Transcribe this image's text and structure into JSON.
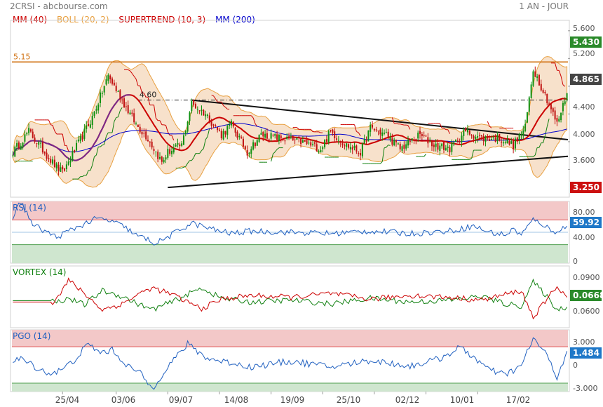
{
  "header": {
    "symbol": "2CRSI - abcbourse.com",
    "period": "1 AN - JOUR"
  },
  "chart_data": [
    {
      "type": "candlestick",
      "legend": [
        {
          "name": "MM (40)",
          "color": "#cc0000"
        },
        {
          "name": "BOLL (20, 2)",
          "color": "#e8a040"
        },
        {
          "name": "SUPERTREND (10, 3)",
          "color": "#cc0000"
        },
        {
          "name": "MM (200)",
          "color": "#0000cc"
        }
      ],
      "yticks": [
        "5.600",
        "5.200",
        "4.800",
        "4.400",
        "4.000",
        "3.600"
      ],
      "ylim": [
        3.2,
        5.75
      ],
      "last_price": "4.865",
      "last_high": "5.430",
      "last_low": "3.250",
      "level_label": "5.15",
      "level_value": 5.15,
      "neckline_label": "4.60",
      "neckline_value": 4.6,
      "price_anchors": [
        [
          0,
          3.85
        ],
        [
          8,
          4.15
        ],
        [
          20,
          3.7
        ],
        [
          25,
          3.55
        ],
        [
          40,
          4.35
        ],
        [
          48,
          4.95
        ],
        [
          55,
          4.6
        ],
        [
          62,
          4.25
        ],
        [
          68,
          4.05
        ],
        [
          75,
          3.7
        ],
        [
          78,
          3.85
        ],
        [
          85,
          3.95
        ],
        [
          90,
          4.55
        ],
        [
          97,
          4.4
        ],
        [
          105,
          4.1
        ],
        [
          110,
          4.25
        ],
        [
          118,
          3.85
        ],
        [
          125,
          4.1
        ],
        [
          135,
          4.05
        ],
        [
          145,
          4.0
        ],
        [
          155,
          3.9
        ],
        [
          160,
          4.15
        ],
        [
          168,
          3.95
        ],
        [
          175,
          3.85
        ],
        [
          180,
          4.2
        ],
        [
          188,
          4.1
        ],
        [
          195,
          3.9
        ],
        [
          205,
          4.1
        ],
        [
          212,
          3.95
        ],
        [
          220,
          3.9
        ],
        [
          228,
          4.15
        ],
        [
          236,
          4.05
        ],
        [
          245,
          4.05
        ],
        [
          252,
          3.95
        ],
        [
          258,
          4.2
        ],
        [
          262,
          5.05
        ],
        [
          266,
          4.8
        ],
        [
          270,
          4.55
        ],
        [
          274,
          4.25
        ],
        [
          279,
          4.7
        ]
      ]
    },
    {
      "type": "line",
      "title": "RSI (14)",
      "yticks": [
        "80.00",
        "40.00",
        "0"
      ],
      "ylim": [
        0,
        100
      ],
      "zones": [
        70,
        30
      ],
      "last_value": "59.92",
      "anchors": [
        [
          0,
          75
        ],
        [
          4,
          100
        ],
        [
          10,
          62
        ],
        [
          22,
          42
        ],
        [
          32,
          58
        ],
        [
          42,
          72
        ],
        [
          50,
          68
        ],
        [
          58,
          55
        ],
        [
          62,
          45
        ],
        [
          68,
          38
        ],
        [
          72,
          32
        ],
        [
          78,
          42
        ],
        [
          90,
          65
        ],
        [
          100,
          55
        ],
        [
          110,
          48
        ],
        [
          120,
          52
        ],
        [
          140,
          50
        ],
        [
          160,
          48
        ],
        [
          180,
          52
        ],
        [
          200,
          48
        ],
        [
          220,
          52
        ],
        [
          232,
          60
        ],
        [
          240,
          50
        ],
        [
          248,
          46
        ],
        [
          252,
          55
        ],
        [
          256,
          46
        ],
        [
          262,
          70
        ],
        [
          266,
          65
        ],
        [
          272,
          50
        ],
        [
          279,
          60
        ]
      ]
    },
    {
      "type": "line",
      "title": "VORTEX (14)",
      "yticks": [
        "0.0900",
        "0.0600"
      ],
      "ylim": [
        0.045,
        0.11
      ],
      "last_value": "0.0668",
      "series": [
        {
          "name": "VI+",
          "color": "#108010",
          "anchors": [
            [
              0,
              0.0735
            ],
            [
              20,
              0.0735
            ],
            [
              22,
              0.072
            ],
            [
              28,
              0.076
            ],
            [
              36,
              0.069
            ],
            [
              45,
              0.084
            ],
            [
              55,
              0.078
            ],
            [
              62,
              0.071
            ],
            [
              70,
              0.064
            ],
            [
              80,
              0.072
            ],
            [
              95,
              0.087
            ],
            [
              105,
              0.076
            ],
            [
              120,
              0.072
            ],
            [
              140,
              0.074
            ],
            [
              160,
              0.07
            ],
            [
              180,
              0.076
            ],
            [
              200,
              0.072
            ],
            [
              220,
              0.074
            ],
            [
              236,
              0.078
            ],
            [
              248,
              0.07
            ],
            [
              256,
              0.068
            ],
            [
              262,
              0.093
            ],
            [
              268,
              0.08
            ],
            [
              274,
              0.064
            ],
            [
              279,
              0.0668
            ]
          ]
        },
        {
          "name": "VI-",
          "color": "#cc0000",
          "anchors": [
            [
              0,
              0.072
            ],
            [
              20,
              0.072
            ],
            [
              22,
              0.076
            ],
            [
              28,
              0.095
            ],
            [
              36,
              0.081
            ],
            [
              45,
              0.064
            ],
            [
              55,
              0.07
            ],
            [
              62,
              0.079
            ],
            [
              70,
              0.087
            ],
            [
              80,
              0.08
            ],
            [
              95,
              0.065
            ],
            [
              105,
              0.075
            ],
            [
              120,
              0.079
            ],
            [
              140,
              0.077
            ],
            [
              160,
              0.081
            ],
            [
              180,
              0.075
            ],
            [
              200,
              0.079
            ],
            [
              220,
              0.077
            ],
            [
              236,
              0.074
            ],
            [
              248,
              0.08
            ],
            [
              256,
              0.084
            ],
            [
              262,
              0.056
            ],
            [
              268,
              0.072
            ],
            [
              274,
              0.089
            ],
            [
              279,
              0.077
            ]
          ]
        }
      ]
    },
    {
      "type": "line",
      "title": "PGO (14)",
      "yticks": [
        "3.000",
        "0",
        "-3.000"
      ],
      "ylim": [
        -3.3,
        4.0
      ],
      "zones": [
        2.0,
        -2.3
      ],
      "last_value": "1.484",
      "anchors": [
        [
          0,
          0.2
        ],
        [
          4,
          0.6
        ],
        [
          10,
          -0.2
        ],
        [
          18,
          -1.2
        ],
        [
          24,
          -0.8
        ],
        [
          30,
          0.2
        ],
        [
          38,
          2.3
        ],
        [
          44,
          1.3
        ],
        [
          50,
          1.6
        ],
        [
          58,
          -0.3
        ],
        [
          65,
          -1.3
        ],
        [
          70,
          -3.0
        ],
        [
          78,
          -0.3
        ],
        [
          88,
          2.3
        ],
        [
          98,
          0.6
        ],
        [
          110,
          0.1
        ],
        [
          120,
          -0.4
        ],
        [
          140,
          0.3
        ],
        [
          160,
          -0.4
        ],
        [
          180,
          0.4
        ],
        [
          200,
          -0.3
        ],
        [
          215,
          0.6
        ],
        [
          225,
          1.9
        ],
        [
          232,
          0.8
        ],
        [
          240,
          -0.8
        ],
        [
          248,
          -1.3
        ],
        [
          256,
          -0.3
        ],
        [
          262,
          3.0
        ],
        [
          268,
          1.3
        ],
        [
          274,
          -1.6
        ],
        [
          279,
          1.484
        ]
      ]
    }
  ],
  "xaxis": {
    "ticks": [
      {
        "label": "25/04",
        "index": 25
      },
      {
        "label": "03/06",
        "index": 52
      },
      {
        "label": "09/07",
        "index": 78
      },
      {
        "label": "14/08",
        "index": 104
      },
      {
        "label": "19/09",
        "index": 130
      },
      {
        "label": "25/10",
        "index": 156
      },
      {
        "label": "02/12",
        "index": 182
      },
      {
        "label": "10/01",
        "index": 208
      },
      {
        "label": "17/02",
        "index": 234
      }
    ],
    "count": 280
  },
  "colors": {
    "up": "#109010",
    "down": "#c01010",
    "boll": "#e8a040",
    "mm40": "#cc0000",
    "mm200": "#0000cc",
    "supertrend_up": "#108010",
    "supertrend_dn": "#cc0000",
    "level": "#d07010",
    "rsi": "#2060c0",
    "pgo": "#2060c0",
    "badge_price": "#444444",
    "badge_high": "#2a8a2a",
    "badge_low": "#cc1010",
    "badge_blue": "#1f78c8",
    "zone_high": "#f3c8c8",
    "zone_low": "#cfe6cf"
  }
}
